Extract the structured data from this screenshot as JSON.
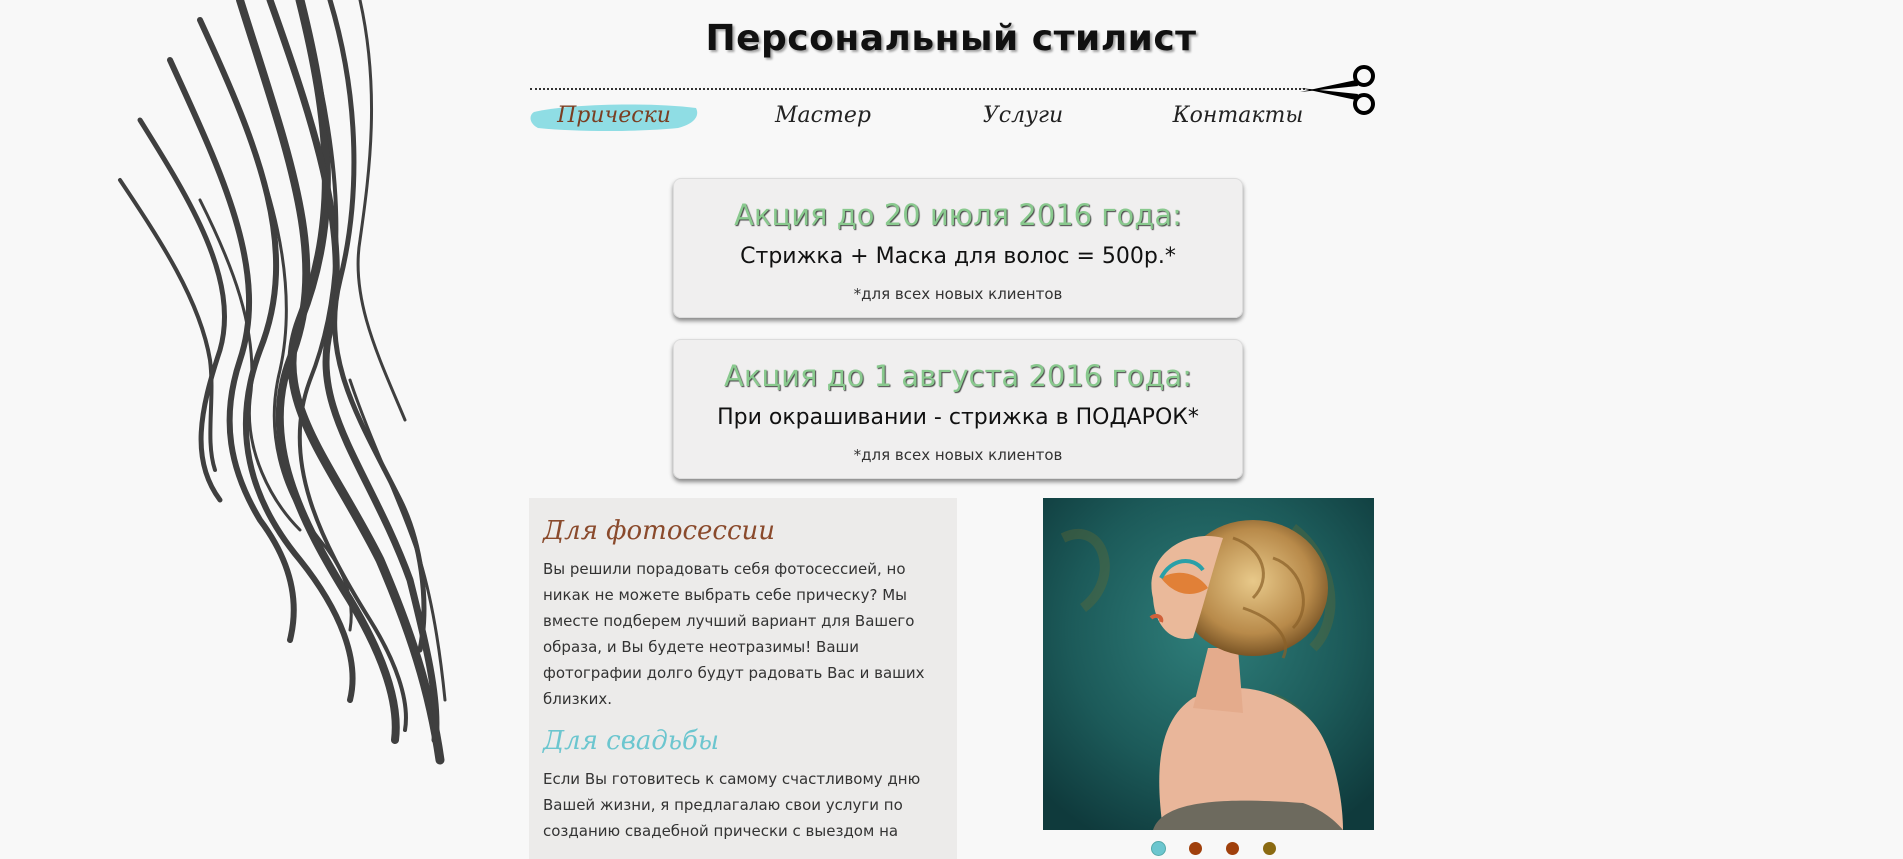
{
  "header": {
    "title": "Персональный стилист"
  },
  "nav": {
    "items": [
      {
        "label": "Прически",
        "active": true
      },
      {
        "label": "Мастер"
      },
      {
        "label": "Услуги"
      },
      {
        "label": "Контакты"
      }
    ]
  },
  "promos": [
    {
      "title": "Акция до 20 июля 2016 года:",
      "offer": "Стрижка + Маска для волос = 500р.*",
      "note": "*для всех новых клиентов"
    },
    {
      "title": "Акция до 1 августа 2016 года:",
      "offer": "При окрашивании - стрижка в ПОДАРОК*",
      "note": "*для всех новых клиентов"
    }
  ],
  "sections": [
    {
      "heading": "Для фотосессии",
      "text": "Вы решили порадовать себя фотосессией, но никак не можете выбрать себе прическу? Мы вместе подберем лучший вариант для Вашего образа, и Вы будете неотразимы! Ваши фотографии долго будут радовать Вас и ваших близких."
    },
    {
      "heading": "Для свадьбы",
      "text": "Если Вы готовитесь к самому счастливому дню Вашей жизни, я предлагалаю свои услуги по созданию свадебной прически с выездом на"
    }
  ],
  "colors": {
    "accent_teal": "#7dd8e0",
    "heading_brown": "#8a4a2c",
    "heading_teal": "#6cc6cf",
    "promo_green": "#89c98e",
    "dot_active": "#6cc6cf",
    "dot_inactive": "#a0400c",
    "dot_last": "#8a6a12"
  },
  "slider": {
    "slides": 4,
    "active_index": 0
  }
}
